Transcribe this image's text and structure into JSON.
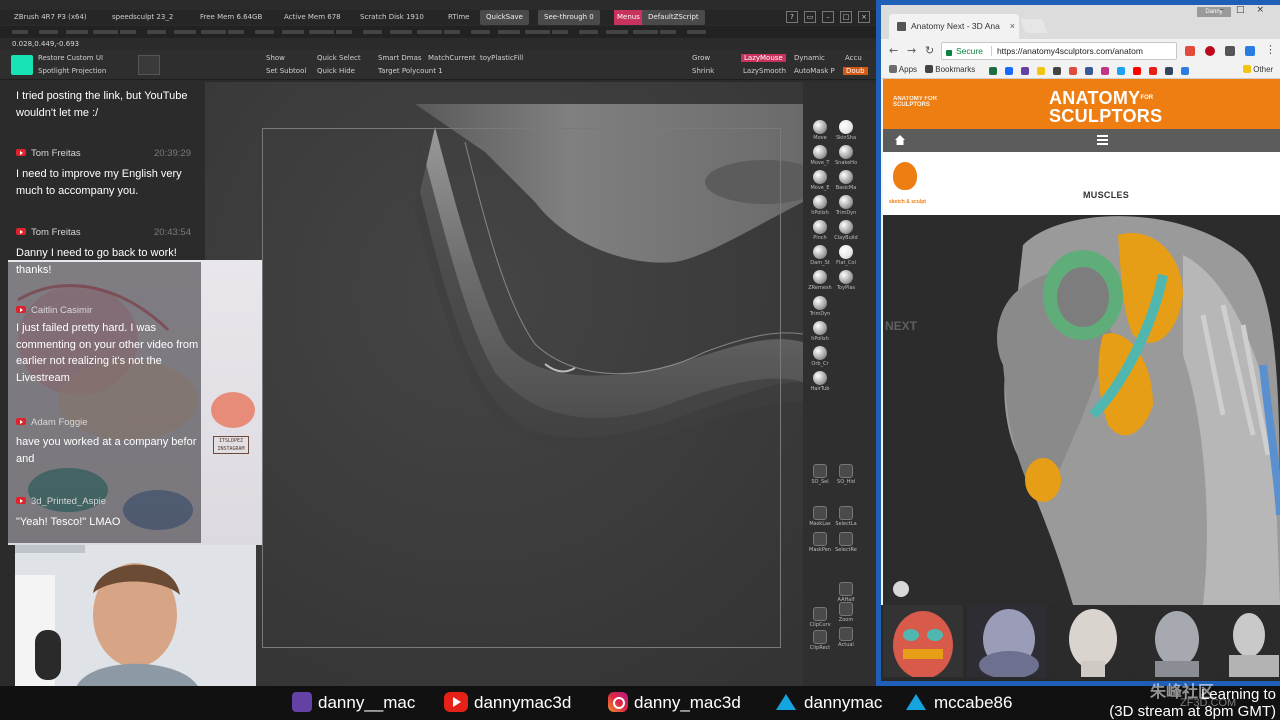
{
  "zbrush": {
    "title": "ZBrush 4R7 P3 (x64)",
    "document": "speedsculpt 23_2",
    "free_mem": "Free Mem 6.64GB",
    "active_mem": "Active Mem 678",
    "scratch_disk": "Scratch Disk 1910",
    "rtime": "RTime",
    "quicksave": "QuickSave",
    "see_through": "See-through  0",
    "menus": "Menus",
    "default_script": "DefaultZScript",
    "coords": "0.028,0.449,-0.693",
    "toolbar": {
      "restore_custom_ui": "Restore Custom UI",
      "spotlight_projection": "Spotlight Projection",
      "show": "Show",
      "quick_select": "Quick Select",
      "smart_dmas": "Smart Dmas",
      "match_current": "MatchCurrent",
      "toy_plastic_fill": "toyPlasticFill",
      "set_subtool": "Set Subtool",
      "quick_hide": "Quick Hide",
      "target_polycount": "Target Polycount 1",
      "grow": "Grow",
      "shrink": "Shrink",
      "lazymouse": "LazyMouse",
      "lazysmooth": "LazySmooth",
      "dynamic": "Dynamic",
      "automask": "AutoMask P",
      "accu": "Accu",
      "dou": "Doub"
    },
    "brushes": [
      {
        "label": "Move"
      },
      {
        "label": "SkinSha"
      },
      {
        "label": "Move_T"
      },
      {
        "label": "SnakeHo"
      },
      {
        "label": "Move_E"
      },
      {
        "label": "BasicMa"
      },
      {
        "label": "hPolish"
      },
      {
        "label": "TrimDyn"
      },
      {
        "label": "Pinch"
      },
      {
        "label": "ClayBuild"
      },
      {
        "label": "Dam_St"
      },
      {
        "label": "Flat_Col"
      },
      {
        "label": "ZRemesh"
      },
      {
        "label": "ToyPlas"
      },
      {
        "label": "TrimDyn"
      },
      {
        "label": "hPolish"
      },
      {
        "label": "Orb_Cr"
      },
      {
        "label": "HairTub"
      }
    ],
    "lower_tools": [
      {
        "label": "SO_Sel"
      },
      {
        "label": "SO_Hid"
      },
      {
        "label": "MaskLas"
      },
      {
        "label": "SelectLa"
      },
      {
        "label": "MaskPen"
      },
      {
        "label": "SelectRe"
      },
      {
        "label": "AAHalf"
      },
      {
        "label": "ClipCurv"
      },
      {
        "label": "Zoom"
      },
      {
        "label": "ClipRect"
      },
      {
        "label": "Actual"
      }
    ]
  },
  "chat": {
    "messages": [
      {
        "author": "",
        "time": "",
        "text": "I tried posting the link, but YouTube wouldn't let me :/"
      },
      {
        "author": "Tom Freitas",
        "time": "20:39:29",
        "text": "I need to improve my English very much to accompany you."
      },
      {
        "author": "Tom Freitas",
        "time": "20:43:54",
        "text": "Danny I need to go back to work! thanks!"
      },
      {
        "author": "Caitlin Casimir",
        "time": "",
        "text": "I just failed pretty hard. I was commenting on your other video from earlier not realizing it's not the Livestream"
      },
      {
        "author": "Adam Foggie",
        "time": "",
        "text": "have you worked at a company befor and"
      },
      {
        "author": "3d_Printed_Aspie",
        "time": "",
        "text": "\"Yeah! Tesco!\" LMAO"
      }
    ],
    "art_stamp": "ITSLDPEZ INSTAGRAM"
  },
  "browser": {
    "tab_title": "Anatomy Next - 3D Ana",
    "profile": "Danny",
    "secure_label": "Secure",
    "url": "https://anatomy4sculptors.com/anatom",
    "bookmarks": [
      {
        "label": "Apps",
        "color": "#5f6368"
      },
      {
        "label": "Bookmarks",
        "color": "#444444"
      }
    ],
    "other_bookmarks": "Other",
    "site": {
      "logo_small": "ANATOMY FOR SCULPTORS",
      "logo_main_1": "ANATOMY",
      "logo_for": "FOR",
      "logo_main_2": "SCULPTORS",
      "sub_icon_label": "sketch & sculpt",
      "section_title": "MUSCLES",
      "viewer_overlay": "NEXT"
    }
  },
  "footer": {
    "twitch": "danny__mac",
    "youtube": "dannymac3d",
    "instagram": "danny_mac3d",
    "artstation": "dannymac",
    "other": "mccabe86",
    "note_line1": "Learning to",
    "note_line2": "(3D stream at 8pm GMT)"
  },
  "watermark": {
    "main": "朱峰社区",
    "sub": "ZF3D.COM"
  },
  "colors": {
    "accent_orange": "#ee7d12",
    "zbrush_pink": "#c8335d",
    "zbrush_swatch": "#18e3b7",
    "browser_frame": "#1f5fb7"
  }
}
